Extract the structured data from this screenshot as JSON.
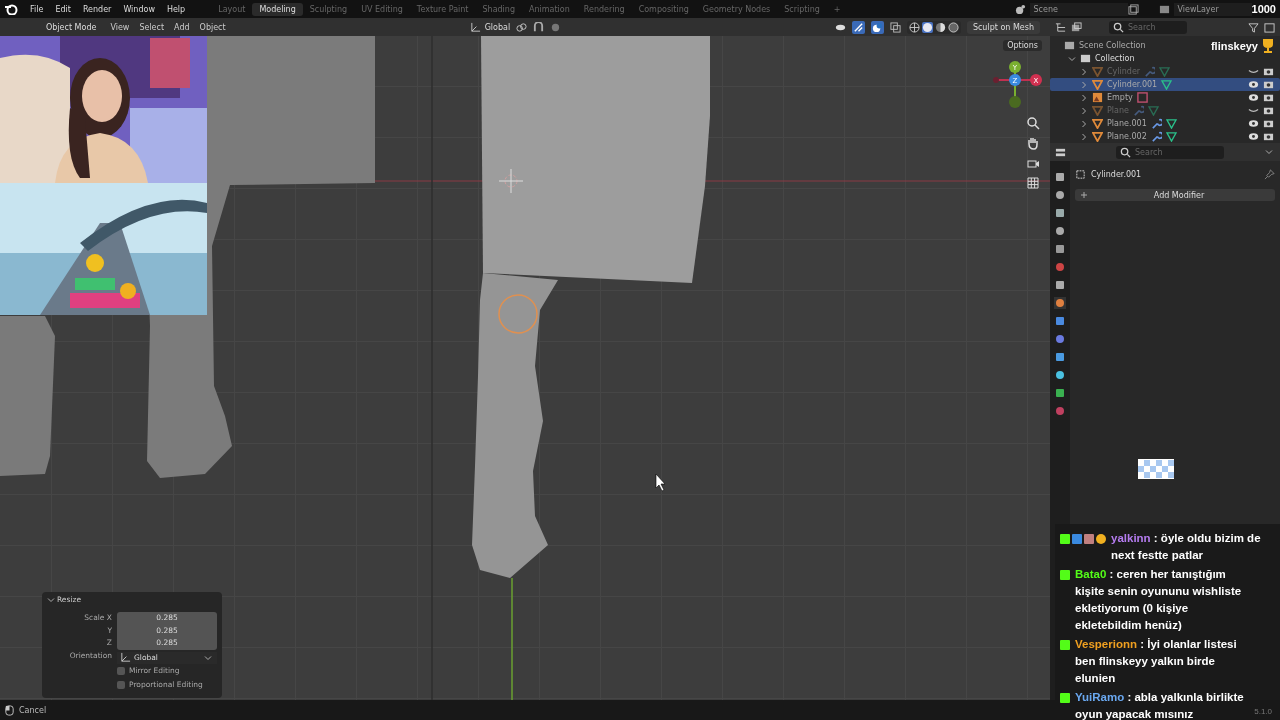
{
  "menu_bar": {
    "menus": [
      "File",
      "Edit",
      "Render",
      "Window",
      "Help"
    ],
    "workspaces": [
      {
        "label": "Layout",
        "selected": false
      },
      {
        "label": "Modeling",
        "selected": true
      },
      {
        "label": "Sculpting",
        "selected": false
      },
      {
        "label": "UV Editing",
        "selected": false
      },
      {
        "label": "Texture Paint",
        "selected": false
      },
      {
        "label": "Shading",
        "selected": false
      },
      {
        "label": "Animation",
        "selected": false
      },
      {
        "label": "Rendering",
        "selected": false
      },
      {
        "label": "Compositing",
        "selected": false
      },
      {
        "label": "Geometry Nodes",
        "selected": false
      },
      {
        "label": "Scripting",
        "selected": false
      }
    ],
    "add_tab": "+",
    "scene": "Scene",
    "view_layer": "ViewLayer",
    "counter": "1000"
  },
  "viewport_header": {
    "mode": "Object Mode",
    "menus": [
      "View",
      "Select",
      "Add",
      "Object"
    ],
    "orientation": "Global",
    "shading_modes": [
      {
        "kind": "wireframe",
        "selected": false
      },
      {
        "kind": "solid",
        "selected": true
      },
      {
        "kind": "material",
        "selected": false
      },
      {
        "kind": "rendered",
        "selected": false
      }
    ],
    "sculpt_button": "Sculpt on Mesh",
    "options": "Options"
  },
  "gizmo": {
    "axes": [
      "Y",
      "Z",
      "X"
    ]
  },
  "outliner": {
    "search_placeholder": "Search",
    "root": "Scene Collection",
    "collection": "Collection",
    "items": [
      {
        "name": "Cylinder",
        "kind": "mesh",
        "visible": false,
        "selected": false,
        "has_modifier": true
      },
      {
        "name": "Cylinder.001",
        "kind": "mesh",
        "visible": true,
        "selected": true,
        "has_modifier": false
      },
      {
        "name": "Empty",
        "kind": "empty",
        "visible": true,
        "selected": false,
        "has_modifier": false
      },
      {
        "name": "Plane",
        "kind": "mesh",
        "visible": false,
        "selected": false,
        "has_modifier": true
      },
      {
        "name": "Plane.001",
        "kind": "mesh",
        "visible": true,
        "selected": false,
        "has_modifier": true
      },
      {
        "name": "Plane.002",
        "kind": "mesh",
        "visible": true,
        "selected": false,
        "has_modifier": true
      }
    ]
  },
  "properties": {
    "search_placeholder": "Search",
    "object": "Cylinder.001",
    "add_modifier": "Add Modifier"
  },
  "resize_panel": {
    "title": "Resize",
    "fields": [
      {
        "label": "Scale X",
        "value": "0.285"
      },
      {
        "label": "Y",
        "value": "0.285"
      },
      {
        "label": "Z",
        "value": "0.285"
      }
    ],
    "orientation_label": "Orientation",
    "orientation": "Global",
    "options": [
      {
        "label": "Mirror Editing",
        "checked": false
      },
      {
        "label": "Proportional Editing",
        "checked": false
      }
    ]
  },
  "status_bar": {
    "hint": "Cancel",
    "version": "5.1.0"
  },
  "stream": {
    "channel": "flinskeyy",
    "chat": [
      {
        "badges": [
          {
            "kind": "kick"
          },
          {
            "kind": "pin"
          },
          {
            "kind": "paw"
          },
          {
            "kind": "coin"
          }
        ],
        "user": "yalkinn",
        "color": "#b57cf0",
        "message": ": öyle oldu bizim de next festte patlar"
      },
      {
        "badges": [
          {
            "kind": "kick"
          }
        ],
        "user": "Bata0",
        "color": "#53fc18",
        "message": ": ceren her tanıştığım kişite senin oyununu wishliste ekletiyorum (0 kişiye ekletebildim henüz)"
      },
      {
        "badges": [
          {
            "kind": "kick"
          }
        ],
        "user": "Vesperionn",
        "color": "#f0a020",
        "message": ": İyi olanlar listesi ben flinskeyy yalkın birde elunien"
      },
      {
        "badges": [
          {
            "kind": "kick"
          }
        ],
        "user": "YuiRamo",
        "color": "#6aa8f0",
        "message": ": abla yalkınla birlikte oyun yapacak mısınız"
      }
    ]
  }
}
